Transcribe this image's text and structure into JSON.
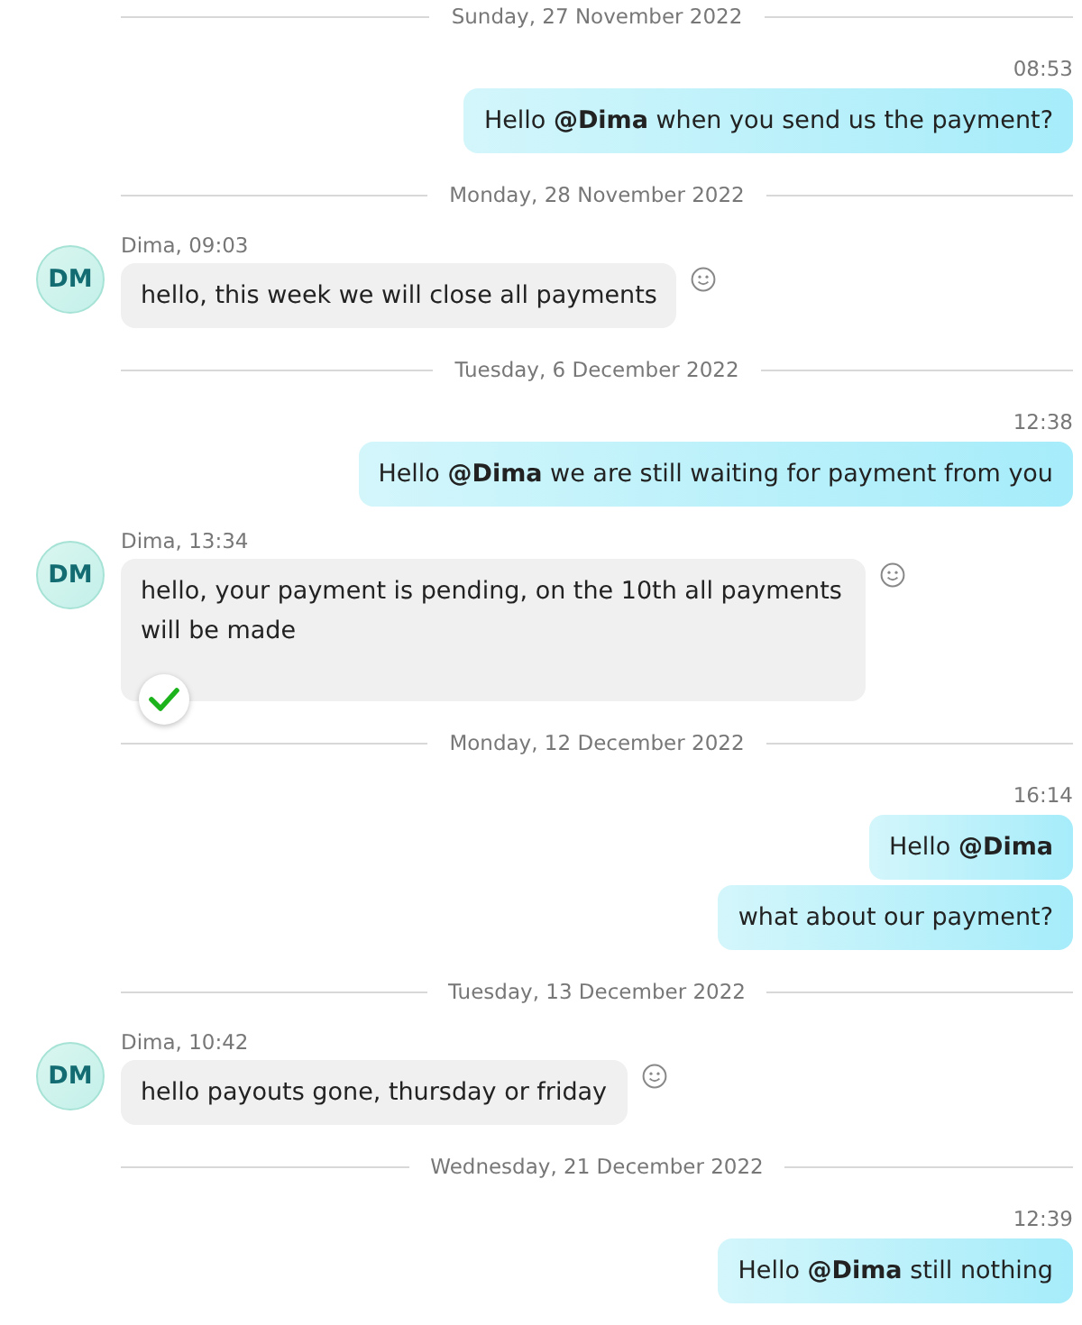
{
  "conversation": [
    {
      "kind": "date",
      "label": "Sunday, 27 November 2022"
    },
    {
      "kind": "outgoing",
      "time": "08:53",
      "messages": [
        "Hello **@Dima** when you send us the payment?"
      ]
    },
    {
      "kind": "date",
      "label": "Monday, 28 November 2022"
    },
    {
      "kind": "incoming",
      "initials": "DM",
      "meta": "Dima, 09:03",
      "text": "hello, this week we will close all payments"
    },
    {
      "kind": "date",
      "label": "Tuesday, 6 December 2022"
    },
    {
      "kind": "outgoing",
      "time": "12:38",
      "messages": [
        "Hello **@Dima** we are still waiting for payment from you"
      ]
    },
    {
      "kind": "incoming",
      "initials": "DM",
      "meta": "Dima, 13:34",
      "text": "hello, your payment is pending, on the 10th all payments will be made",
      "reaction": {
        "kind": "check"
      }
    },
    {
      "kind": "date",
      "label": "Monday, 12 December 2022"
    },
    {
      "kind": "outgoing",
      "time": "16:14",
      "messages": [
        "Hello **@Dima**",
        "what about our payment?"
      ]
    },
    {
      "kind": "date",
      "label": "Tuesday, 13 December 2022"
    },
    {
      "kind": "incoming",
      "initials": "DM",
      "meta": "Dima, 10:42",
      "text": "hello payouts gone, thursday or friday"
    },
    {
      "kind": "date",
      "label": "Wednesday, 21 December 2022"
    },
    {
      "kind": "outgoing",
      "time": "12:39",
      "messages": [
        "Hello **@Dima** still nothing"
      ]
    }
  ]
}
